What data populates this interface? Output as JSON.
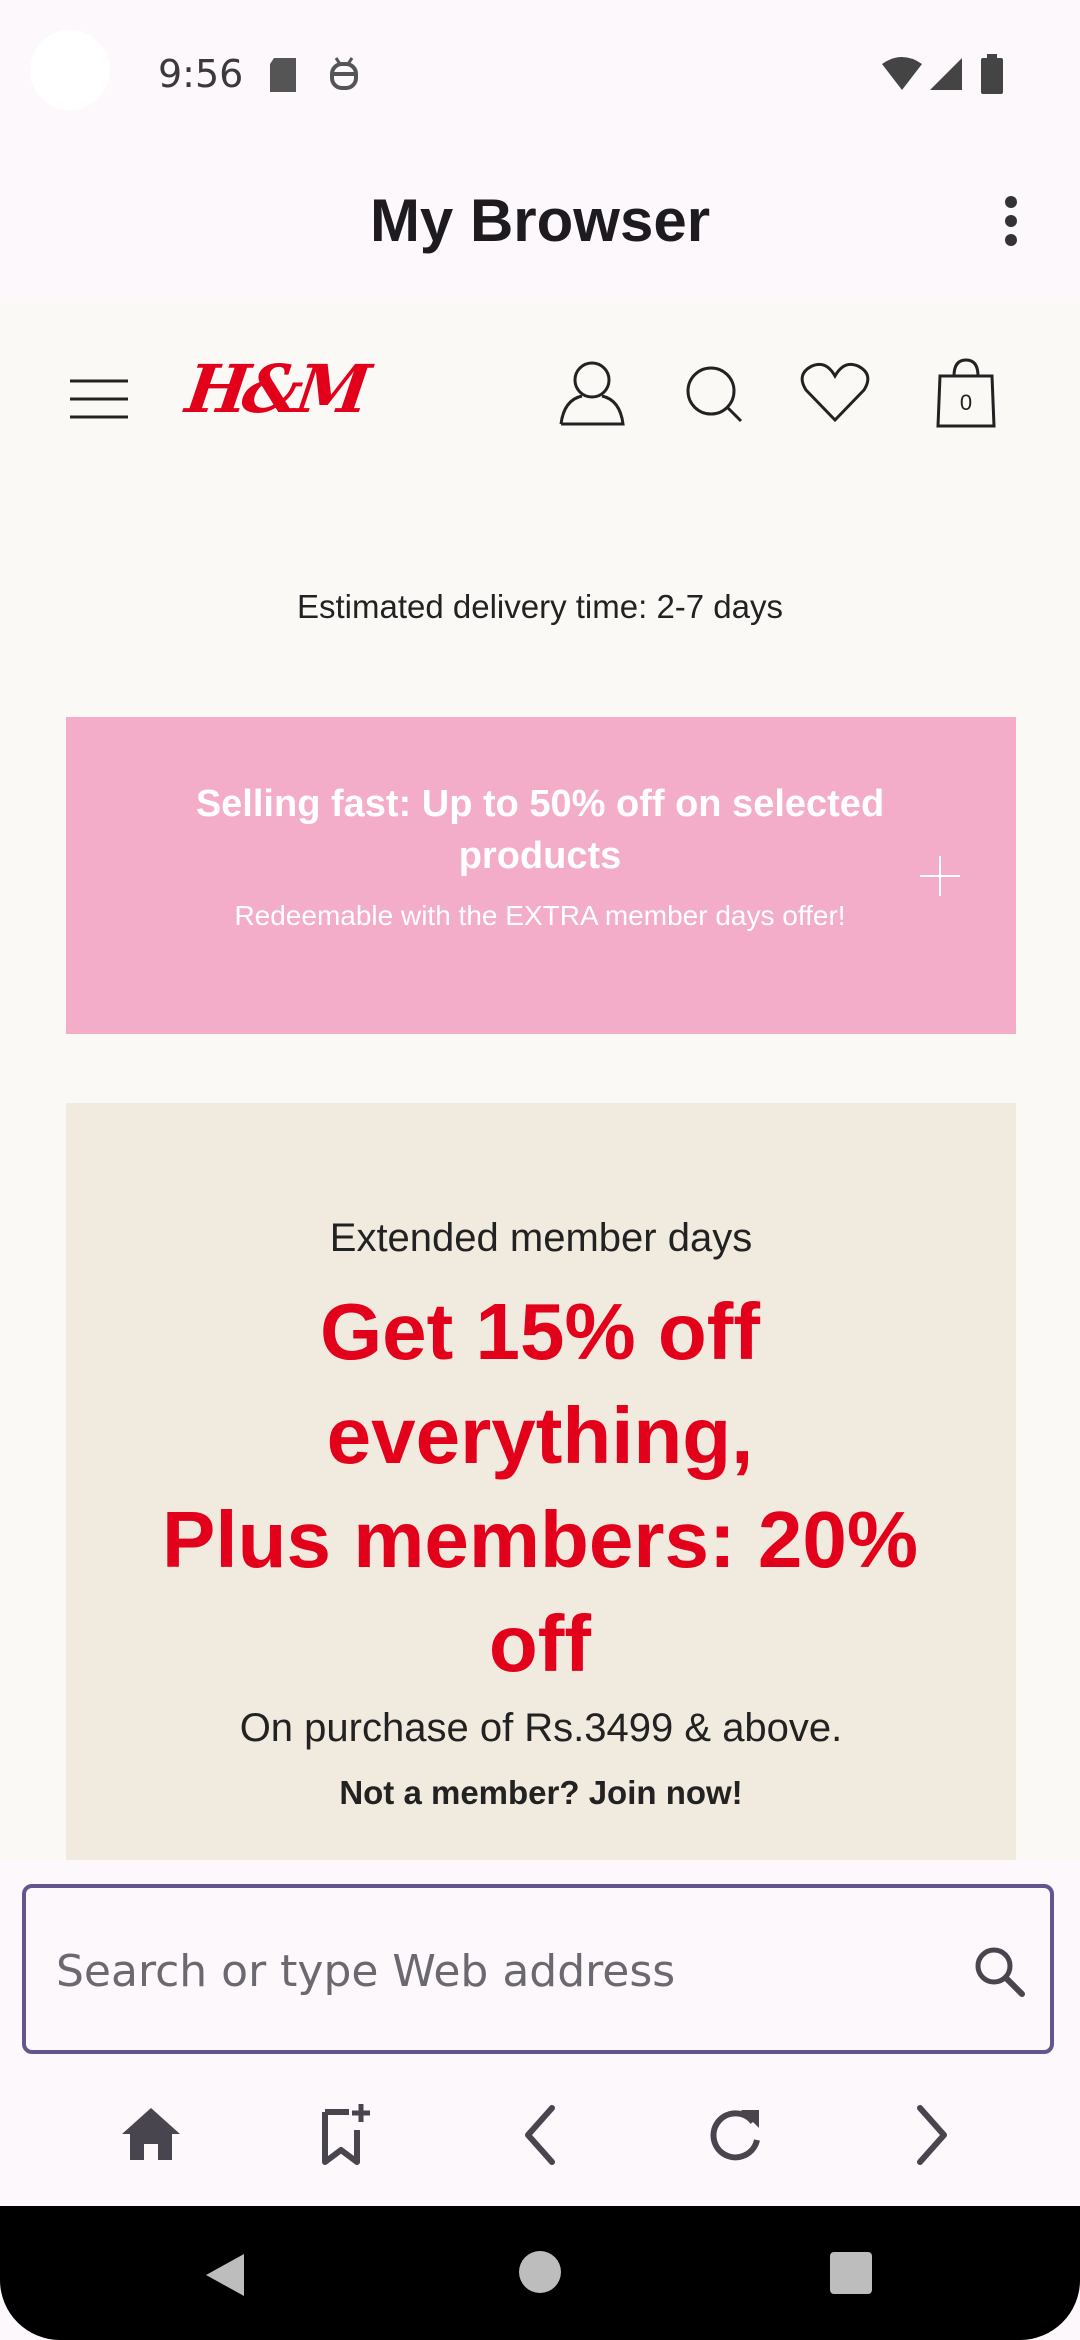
{
  "status_bar": {
    "time": "9:56"
  },
  "app_bar": {
    "title": "My Browser"
  },
  "site": {
    "logo_text": "H&M",
    "cart_count": "0",
    "delivery_text": "Estimated delivery time: 2-7 days",
    "brand_color": "#e2001a",
    "promo_pink": {
      "title": "Selling fast: Up to 50% off on selected products",
      "subtitle": "Redeemable with the EXTRA member days offer!",
      "background": "#f3adc8"
    },
    "promo_beige": {
      "subtitle": "Extended member days",
      "headline_line1": "Get 15% off everything,",
      "headline_line2": "Plus members: 20% off",
      "purchase_note": "On purchase of Rs.3499 & above.",
      "join_text": "Not a member? Join now!",
      "background": "#f0eadf"
    }
  },
  "search": {
    "placeholder": "Search or type Web address",
    "value": ""
  },
  "bottom_nav": [
    "home-icon",
    "bookmark-add-icon",
    "back-icon",
    "reload-icon",
    "forward-icon"
  ],
  "accent_color": "#65558f"
}
